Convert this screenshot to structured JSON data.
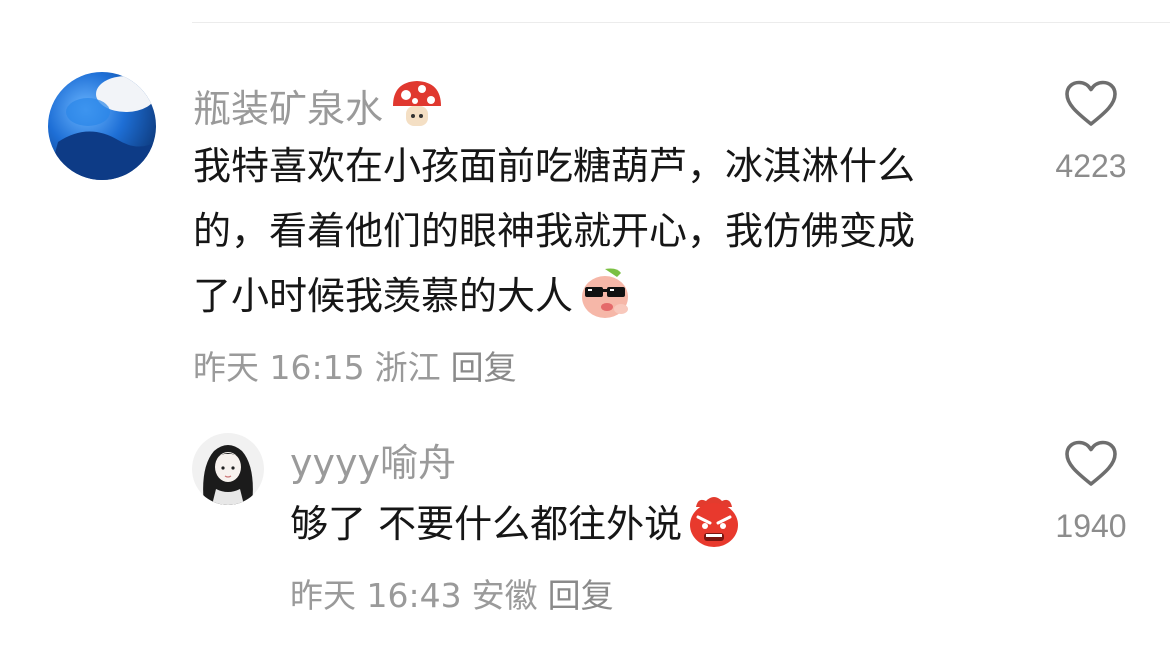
{
  "comments": [
    {
      "username": "瓶装矿泉水",
      "badge_icon": "mushroom-icon",
      "text_lines": [
        "我特喜欢在小孩面前吃糖葫芦，冰淇淋什么",
        "的，看着他们的眼神我就开心，我仿佛变成",
        "了小时候我羡慕的大人"
      ],
      "emoji_icon": "cool-sunglasses-emoji",
      "time": "昨天 16:15",
      "location": "浙江",
      "reply_label": "回复",
      "likes": "4223",
      "avatar_color": "#1f6fd1"
    },
    {
      "username": "yyyy喻舟",
      "text": "够了 不要什么都往外说",
      "emoji_icon": "angry-face-emoji",
      "time": "昨天 16:43",
      "location": "安徽",
      "reply_label": "回复",
      "likes": "1940"
    }
  ],
  "colors": {
    "text_primary": "#161616",
    "text_secondary": "#9a9a9a",
    "heart_outline": "#6e6e6e",
    "divider": "#ececec"
  }
}
